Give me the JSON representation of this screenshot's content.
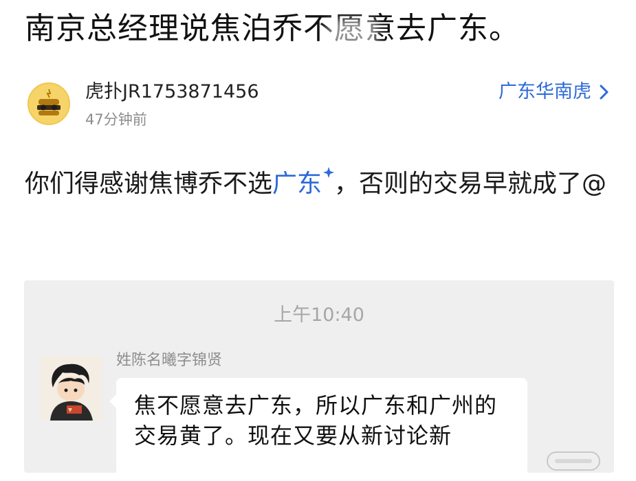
{
  "title": "南京总经理说焦泊乔不愿意去广东。",
  "author": {
    "name": "虎扑JR1753871456",
    "time": "47分钟前",
    "avatar_icon": "sunglasses-burger-avatar-icon"
  },
  "forum": {
    "label": "广东华南虎",
    "icon": "chevron-right-icon"
  },
  "post": {
    "text_before": "你们得感谢焦博乔不选",
    "link": "广东",
    "link_icon": "sparkle-link-icon",
    "text_after": "，否则的交易早就成了@"
  },
  "chat": {
    "time": "上午10:40",
    "sender": "姓陈名曦字锦贤",
    "message": "焦不愿意去广东，所以广东和广州的交易黄了。现在又要从新讨论新",
    "avatar_icon": "anime-boy-avatar-icon"
  },
  "colors": {
    "link_blue": "#2d6ad8",
    "chat_bg": "#efefef",
    "meta_gray": "#8c8c8c"
  }
}
